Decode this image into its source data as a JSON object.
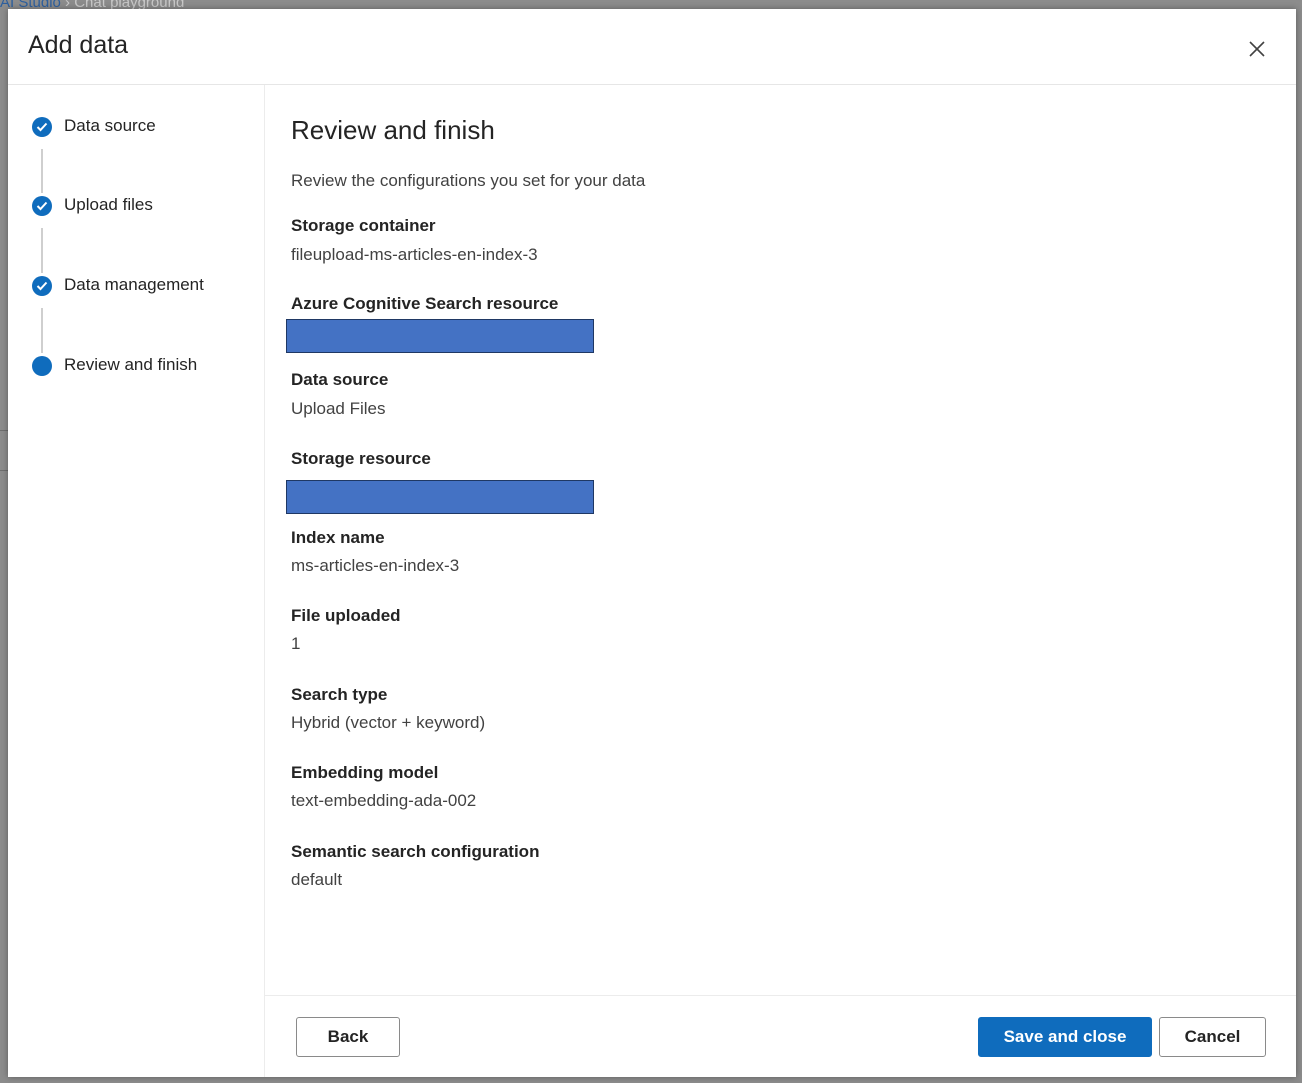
{
  "backdrop": {
    "breadcrumb_link": "AI Studio",
    "breadcrumb_sep": "›",
    "breadcrumb_current": "Chat playground"
  },
  "dialog": {
    "title": "Add data",
    "close_icon": "close-icon"
  },
  "steps": [
    {
      "label": "Data source",
      "status": "completed"
    },
    {
      "label": "Upload files",
      "status": "completed"
    },
    {
      "label": "Data management",
      "status": "completed"
    },
    {
      "label": "Review and finish",
      "status": "current"
    }
  ],
  "review": {
    "title": "Review and finish",
    "description": "Review the configurations you set for your data",
    "fields": [
      {
        "label": "Storage container",
        "value": "fileupload-ms-articles-en-index-3",
        "redacted": false
      },
      {
        "label": "Azure Cognitive Search resource",
        "value": "",
        "redacted": true
      },
      {
        "label": "Data source",
        "value": "Upload Files",
        "redacted": false
      },
      {
        "label": "Storage resource",
        "value": "",
        "redacted": true
      },
      {
        "label": "Index name",
        "value": "ms-articles-en-index-3",
        "redacted": false
      },
      {
        "label": "File uploaded",
        "value": "1",
        "redacted": false
      },
      {
        "label": "Search type",
        "value": "Hybrid (vector + keyword)",
        "redacted": false
      },
      {
        "label": "Embedding model",
        "value": "text-embedding-ada-002",
        "redacted": false
      },
      {
        "label": "Semantic search configuration",
        "value": "default",
        "redacted": false
      }
    ]
  },
  "footer": {
    "back_label": "Back",
    "save_label": "Save and close",
    "cancel_label": "Cancel"
  },
  "colors": {
    "accent": "#0f6cbd",
    "redaction": "#4472c4"
  }
}
